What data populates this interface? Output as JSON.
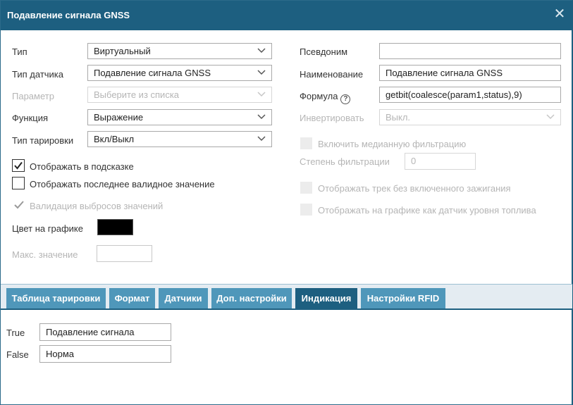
{
  "dialog": {
    "title": "Подавление сигнала GNSS",
    "close_symbol": "✕"
  },
  "left": {
    "type_label": "Тип",
    "type_value": "Виртуальный",
    "sensor_type_label": "Тип датчика",
    "sensor_type_value": "Подавление сигнала GNSS",
    "param_label": "Параметр",
    "param_placeholder": "Выберите из списка",
    "function_label": "Функция",
    "function_value": "Выражение",
    "calib_type_label": "Тип тарировки",
    "calib_type_value": "Вкл/Выкл",
    "show_in_tooltip": "Отображать в подсказке",
    "show_last_valid": "Отображать последнее валидное значение",
    "outlier_validation": "Валидация выбросов значений",
    "chart_color_label": "Цвет на графике",
    "chart_color": "#000000",
    "max_value_label": "Макс. значение",
    "max_value": ""
  },
  "right": {
    "alias_label": "Псевдоним",
    "alias_value": "",
    "name_label": "Наименование",
    "name_value": "Подавление сигнала GNSS",
    "formula_label": "Формула",
    "formula_help": "?",
    "formula_value": "getbit(coalesce(param1,status),9)",
    "invert_label": "Инвертировать",
    "invert_value": "Выкл.",
    "median_filter": "Включить медианную фильтрацию",
    "filter_degree_label": "Степень фильтрации",
    "filter_degree_value": "0",
    "track_without_ignition": "Отображать трек без включенного зажигания",
    "fuel_level_sensor": "Отображать на графике как датчик уровня топлива"
  },
  "tabs": [
    {
      "label": "Таблица тарировки"
    },
    {
      "label": "Формат"
    },
    {
      "label": "Датчики"
    },
    {
      "label": "Доп. настройки"
    },
    {
      "label": "Индикация"
    },
    {
      "label": "Настройки RFID"
    }
  ],
  "indication": {
    "true_label": "True",
    "true_value": "Подавление сигнала",
    "false_label": "False",
    "false_value": "Норма"
  },
  "colors": {
    "title_bar": "#1d5f80",
    "tab": "#4f97ba",
    "tab_active": "#1d5f80"
  }
}
